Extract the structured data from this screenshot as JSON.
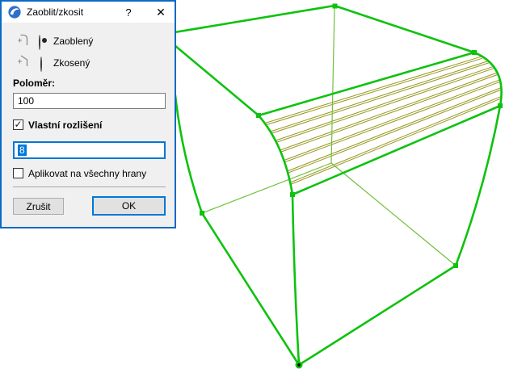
{
  "dialog": {
    "title": "Zaoblit/zkosit",
    "help_label": "?",
    "close_label": "✕",
    "radio_rounded_label": "Zaoblený",
    "radio_chamfer_label": "Zkosený",
    "radius_label": "Poloměr:",
    "radius_value": "100",
    "custom_resolution_label": "Vlastní rozlišení",
    "custom_resolution_checked": "✓",
    "resolution_value": "8",
    "apply_all_label": "Aplikovat na všechny hrany",
    "cancel_label": "Zrušit",
    "ok_label": "OK"
  },
  "colors": {
    "edge_green": "#0ec20e",
    "hidden_edge_green": "#6fc13c",
    "fillet_hatch_olive": "#96961e",
    "handle_green": "#0ec20e",
    "hotspot_center": "#000000",
    "dialog_border_blue": "#0c69c5",
    "accent_blue": "#0078d7",
    "logo_blue": "#2e6fc9"
  }
}
